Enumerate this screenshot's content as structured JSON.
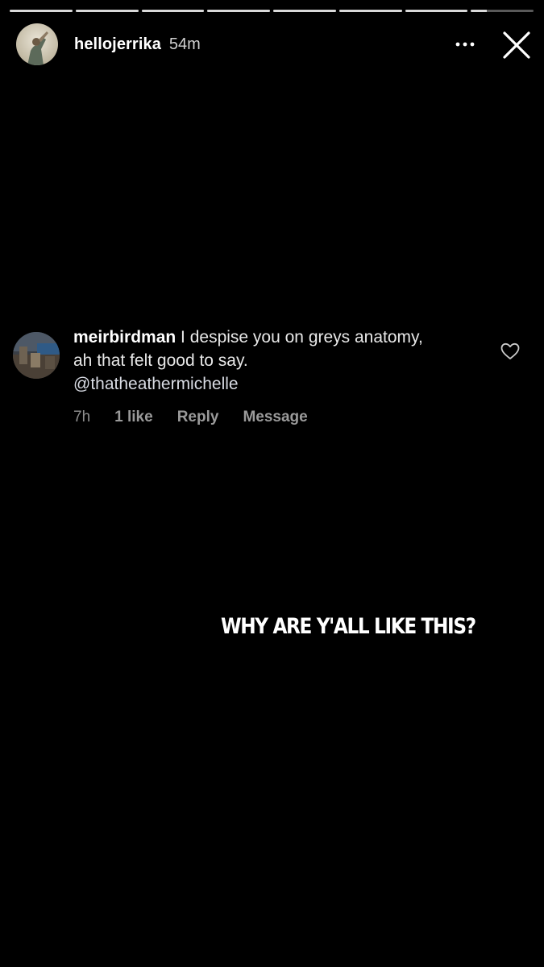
{
  "story": {
    "username": "hellojerrika",
    "time_ago": "54m",
    "segment_count": 8,
    "current_segment_progress": 0.25
  },
  "header_icons": {
    "more": "more-horizontal-icon",
    "close": "close-icon"
  },
  "comment": {
    "username": "meirbirdman",
    "text": "I despise you on greys anatomy, ah that felt good to say.",
    "mention": "@thatheathermichelle",
    "time": "7h",
    "likes": "1 like",
    "reply_label": "Reply",
    "message_label": "Message",
    "like_icon": "heart-outline-icon"
  },
  "caption": "WHY ARE Y'ALL LIKE THIS?",
  "colors": {
    "background": "#000000",
    "text": "#ffffff",
    "muted": "#8e8e8e"
  }
}
